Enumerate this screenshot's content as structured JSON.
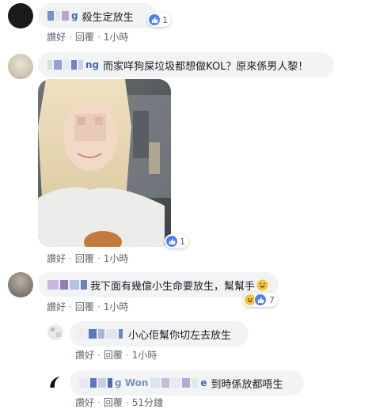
{
  "comments": [
    {
      "name_tail": "g",
      "text": "殺生定放生",
      "reaction_count": "1",
      "actions": {
        "like": "讚好",
        "reply": "回覆",
        "time": "1小時"
      }
    },
    {
      "name_tail": "ng",
      "text": "而家咩狗屎垃圾都想做KOL？原來係男人黎！",
      "reaction_count": "1",
      "actions": {
        "like": "讚好",
        "reply": "回覆",
        "time": "1小時"
      }
    },
    {
      "name_tail": "",
      "text": "我下面有幾億小生命要放生，幫幫手",
      "reaction_count": "7",
      "actions": {
        "like": "讚好",
        "reply": "回覆",
        "time": "1小時"
      }
    }
  ],
  "replies": [
    {
      "name_tail": "",
      "text": "小心佢幫你切左去放生",
      "actions": {
        "like": "讚好",
        "reply": "回覆",
        "time": "1小時"
      }
    },
    {
      "name_tail": "g Won",
      "name_end": "e",
      "text": "到時係放都唔生",
      "actions": {
        "like": "讚好",
        "reply": "回覆",
        "time": "51分鐘"
      }
    }
  ],
  "separator": "·",
  "colors": {
    "link_blue": "#4267b2",
    "bubble_bg": "#f2f3f5",
    "meta_gray": "#606770",
    "like_blue": "#4a7ff7",
    "haha_yellow": "#f7c440"
  },
  "icons": [
    "like-icon",
    "haha-icon",
    "smile-emoji-icon"
  ]
}
